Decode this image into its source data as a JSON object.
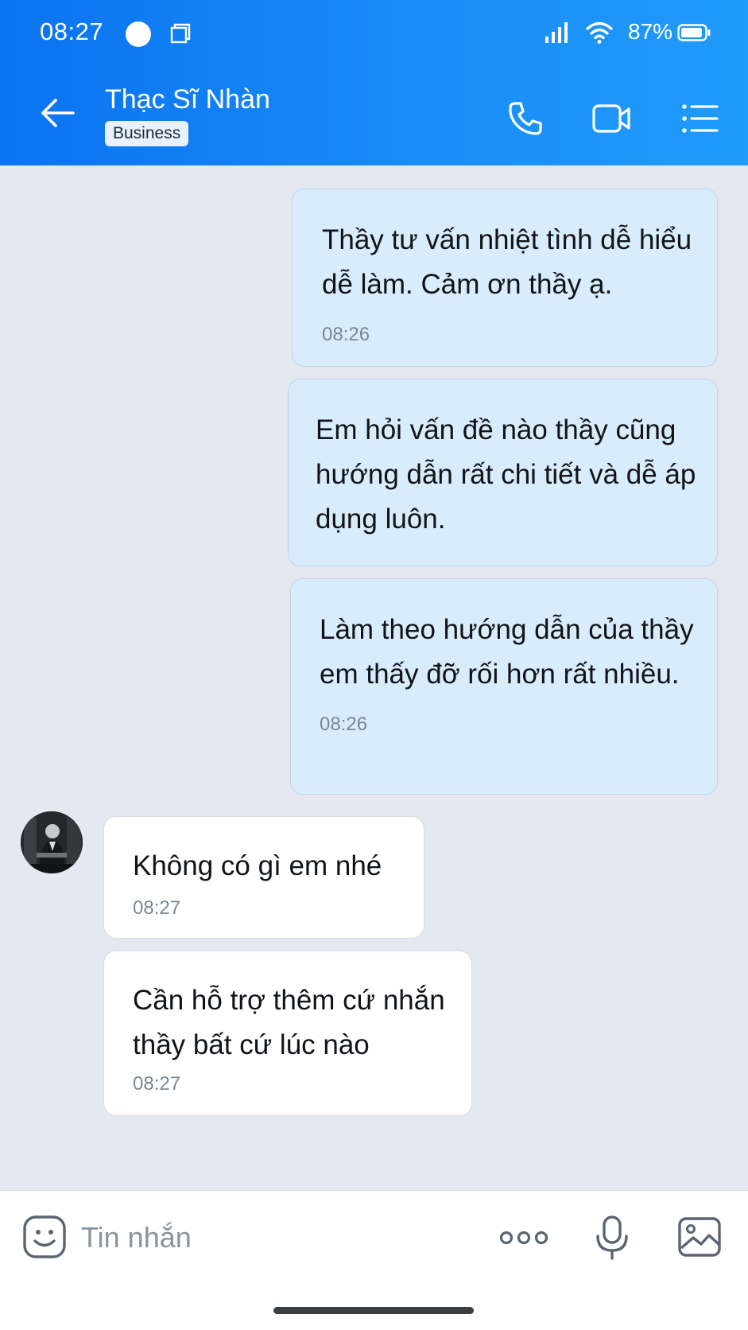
{
  "status_bar": {
    "time": "08:27",
    "battery": "87%"
  },
  "header": {
    "contact_name": "Thạc Sĩ Nhàn",
    "badge": "Business"
  },
  "messages": [
    {
      "direction": "out",
      "text": "Thầy tư vấn nhiệt tình dễ hiểu dễ làm. Cảm ơn thầy ạ.",
      "time": "08:26"
    },
    {
      "direction": "out",
      "text": "Em hỏi vấn đề nào thầy cũng hướng dẫn rất chi tiết và dễ áp dụng luôn.",
      "time": ""
    },
    {
      "direction": "out",
      "text": "Làm theo hướng dẫn của thầy em thấy đỡ rối hơn rất nhiều.",
      "time": "08:26"
    },
    {
      "direction": "in",
      "text": "Không có gì em nhé",
      "time": "08:27"
    },
    {
      "direction": "in",
      "text": "Cần hỗ trợ thêm cứ nhắn thầy bất cứ lúc nào",
      "time": "08:27"
    }
  ],
  "composer": {
    "placeholder": "Tin nhắn"
  },
  "colors": {
    "header_start": "#0a73f0",
    "header_end": "#1f9bfb",
    "outgoing_bubble": "#d9ecfc",
    "incoming_bubble": "#ffffff",
    "chat_background": "#e4e8f1"
  }
}
